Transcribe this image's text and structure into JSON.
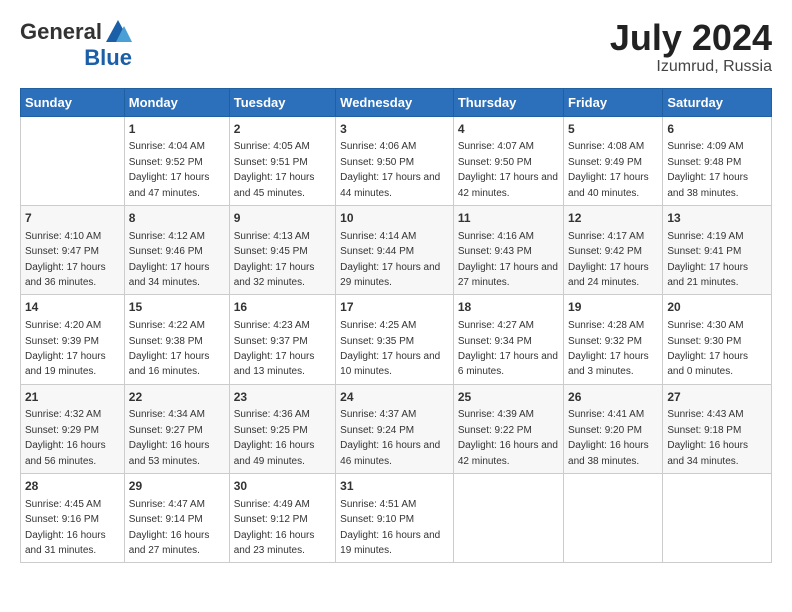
{
  "header": {
    "logo_general": "General",
    "logo_blue": "Blue",
    "title": "July 2024",
    "location": "Izumrud, Russia"
  },
  "days_of_week": [
    "Sunday",
    "Monday",
    "Tuesday",
    "Wednesday",
    "Thursday",
    "Friday",
    "Saturday"
  ],
  "weeks": [
    [
      {
        "day": "",
        "sunrise": "",
        "sunset": "",
        "daylight": ""
      },
      {
        "day": "1",
        "sunrise": "Sunrise: 4:04 AM",
        "sunset": "Sunset: 9:52 PM",
        "daylight": "Daylight: 17 hours and 47 minutes."
      },
      {
        "day": "2",
        "sunrise": "Sunrise: 4:05 AM",
        "sunset": "Sunset: 9:51 PM",
        "daylight": "Daylight: 17 hours and 45 minutes."
      },
      {
        "day": "3",
        "sunrise": "Sunrise: 4:06 AM",
        "sunset": "Sunset: 9:50 PM",
        "daylight": "Daylight: 17 hours and 44 minutes."
      },
      {
        "day": "4",
        "sunrise": "Sunrise: 4:07 AM",
        "sunset": "Sunset: 9:50 PM",
        "daylight": "Daylight: 17 hours and 42 minutes."
      },
      {
        "day": "5",
        "sunrise": "Sunrise: 4:08 AM",
        "sunset": "Sunset: 9:49 PM",
        "daylight": "Daylight: 17 hours and 40 minutes."
      },
      {
        "day": "6",
        "sunrise": "Sunrise: 4:09 AM",
        "sunset": "Sunset: 9:48 PM",
        "daylight": "Daylight: 17 hours and 38 minutes."
      }
    ],
    [
      {
        "day": "7",
        "sunrise": "Sunrise: 4:10 AM",
        "sunset": "Sunset: 9:47 PM",
        "daylight": "Daylight: 17 hours and 36 minutes."
      },
      {
        "day": "8",
        "sunrise": "Sunrise: 4:12 AM",
        "sunset": "Sunset: 9:46 PM",
        "daylight": "Daylight: 17 hours and 34 minutes."
      },
      {
        "day": "9",
        "sunrise": "Sunrise: 4:13 AM",
        "sunset": "Sunset: 9:45 PM",
        "daylight": "Daylight: 17 hours and 32 minutes."
      },
      {
        "day": "10",
        "sunrise": "Sunrise: 4:14 AM",
        "sunset": "Sunset: 9:44 PM",
        "daylight": "Daylight: 17 hours and 29 minutes."
      },
      {
        "day": "11",
        "sunrise": "Sunrise: 4:16 AM",
        "sunset": "Sunset: 9:43 PM",
        "daylight": "Daylight: 17 hours and 27 minutes."
      },
      {
        "day": "12",
        "sunrise": "Sunrise: 4:17 AM",
        "sunset": "Sunset: 9:42 PM",
        "daylight": "Daylight: 17 hours and 24 minutes."
      },
      {
        "day": "13",
        "sunrise": "Sunrise: 4:19 AM",
        "sunset": "Sunset: 9:41 PM",
        "daylight": "Daylight: 17 hours and 21 minutes."
      }
    ],
    [
      {
        "day": "14",
        "sunrise": "Sunrise: 4:20 AM",
        "sunset": "Sunset: 9:39 PM",
        "daylight": "Daylight: 17 hours and 19 minutes."
      },
      {
        "day": "15",
        "sunrise": "Sunrise: 4:22 AM",
        "sunset": "Sunset: 9:38 PM",
        "daylight": "Daylight: 17 hours and 16 minutes."
      },
      {
        "day": "16",
        "sunrise": "Sunrise: 4:23 AM",
        "sunset": "Sunset: 9:37 PM",
        "daylight": "Daylight: 17 hours and 13 minutes."
      },
      {
        "day": "17",
        "sunrise": "Sunrise: 4:25 AM",
        "sunset": "Sunset: 9:35 PM",
        "daylight": "Daylight: 17 hours and 10 minutes."
      },
      {
        "day": "18",
        "sunrise": "Sunrise: 4:27 AM",
        "sunset": "Sunset: 9:34 PM",
        "daylight": "Daylight: 17 hours and 6 minutes."
      },
      {
        "day": "19",
        "sunrise": "Sunrise: 4:28 AM",
        "sunset": "Sunset: 9:32 PM",
        "daylight": "Daylight: 17 hours and 3 minutes."
      },
      {
        "day": "20",
        "sunrise": "Sunrise: 4:30 AM",
        "sunset": "Sunset: 9:30 PM",
        "daylight": "Daylight: 17 hours and 0 minutes."
      }
    ],
    [
      {
        "day": "21",
        "sunrise": "Sunrise: 4:32 AM",
        "sunset": "Sunset: 9:29 PM",
        "daylight": "Daylight: 16 hours and 56 minutes."
      },
      {
        "day": "22",
        "sunrise": "Sunrise: 4:34 AM",
        "sunset": "Sunset: 9:27 PM",
        "daylight": "Daylight: 16 hours and 53 minutes."
      },
      {
        "day": "23",
        "sunrise": "Sunrise: 4:36 AM",
        "sunset": "Sunset: 9:25 PM",
        "daylight": "Daylight: 16 hours and 49 minutes."
      },
      {
        "day": "24",
        "sunrise": "Sunrise: 4:37 AM",
        "sunset": "Sunset: 9:24 PM",
        "daylight": "Daylight: 16 hours and 46 minutes."
      },
      {
        "day": "25",
        "sunrise": "Sunrise: 4:39 AM",
        "sunset": "Sunset: 9:22 PM",
        "daylight": "Daylight: 16 hours and 42 minutes."
      },
      {
        "day": "26",
        "sunrise": "Sunrise: 4:41 AM",
        "sunset": "Sunset: 9:20 PM",
        "daylight": "Daylight: 16 hours and 38 minutes."
      },
      {
        "day": "27",
        "sunrise": "Sunrise: 4:43 AM",
        "sunset": "Sunset: 9:18 PM",
        "daylight": "Daylight: 16 hours and 34 minutes."
      }
    ],
    [
      {
        "day": "28",
        "sunrise": "Sunrise: 4:45 AM",
        "sunset": "Sunset: 9:16 PM",
        "daylight": "Daylight: 16 hours and 31 minutes."
      },
      {
        "day": "29",
        "sunrise": "Sunrise: 4:47 AM",
        "sunset": "Sunset: 9:14 PM",
        "daylight": "Daylight: 16 hours and 27 minutes."
      },
      {
        "day": "30",
        "sunrise": "Sunrise: 4:49 AM",
        "sunset": "Sunset: 9:12 PM",
        "daylight": "Daylight: 16 hours and 23 minutes."
      },
      {
        "day": "31",
        "sunrise": "Sunrise: 4:51 AM",
        "sunset": "Sunset: 9:10 PM",
        "daylight": "Daylight: 16 hours and 19 minutes."
      },
      {
        "day": "",
        "sunrise": "",
        "sunset": "",
        "daylight": ""
      },
      {
        "day": "",
        "sunrise": "",
        "sunset": "",
        "daylight": ""
      },
      {
        "day": "",
        "sunrise": "",
        "sunset": "",
        "daylight": ""
      }
    ]
  ]
}
